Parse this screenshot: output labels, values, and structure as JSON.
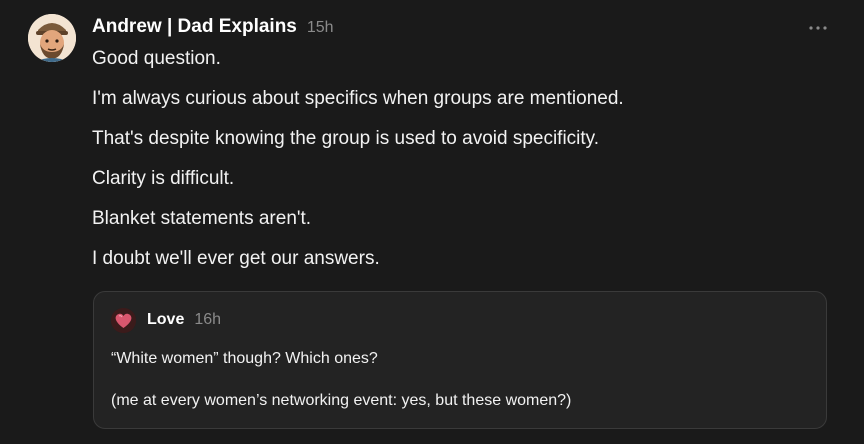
{
  "note": {
    "author": "Andrew | Dad Explains",
    "timestamp": "15h",
    "more_icon": "ellipsis-icon",
    "body": [
      "Good question.",
      "I'm always curious about specifics when groups are mentioned.",
      "That's despite knowing the group is used to avoid specificity.",
      "Clarity is difficult.",
      "Blanket statements aren't.",
      "I doubt we'll ever get our answers."
    ]
  },
  "quoted_note": {
    "author": "Love",
    "timestamp": "16h",
    "lines": [
      "“White women” though? Which ones?",
      "(me at every women’s networking event: yes, but these women?)"
    ]
  },
  "colors": {
    "background": "#1a1a1a",
    "card_background": "#232323",
    "card_border": "#3a3a3a",
    "muted_text": "#8a8a8a"
  }
}
